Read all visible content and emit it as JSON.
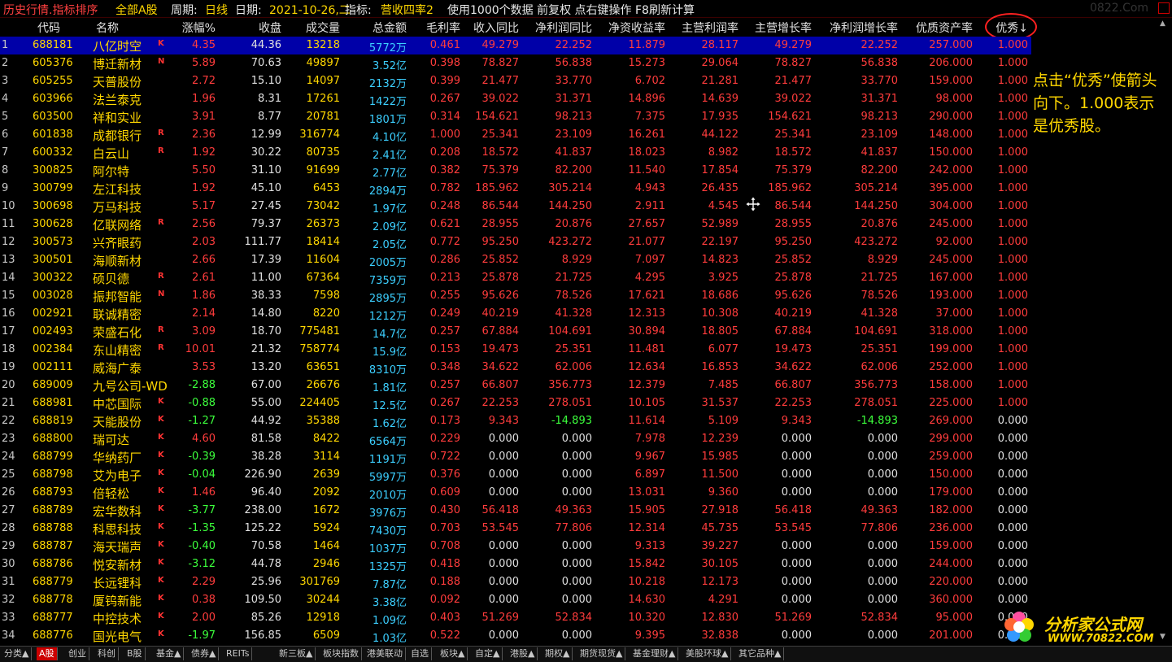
{
  "title": {
    "part1": "历史行情.指标排序",
    "part2": "全部A股",
    "part3": "周期:",
    "part4": "日线",
    "part5": "日期:",
    "part6": "2021-10-26,二",
    "part7": "指标:",
    "part8": "营收四率2",
    "part9": "使用1000个数据 前复权 点右键操作 F8刷新计算",
    "watermark": "0822.Com"
  },
  "columns": [
    "代码",
    "名称",
    "涨幅%",
    "收盘",
    "成交量",
    "总金额",
    "毛利率",
    "收入同比",
    "净利润同比",
    "净资收益率",
    "主营利润率",
    "主营增长率",
    "净利润增长率",
    "优质资产率",
    "优秀↓"
  ],
  "rows": [
    {
      "n": "1",
      "code": "688181",
      "name": "八亿时空",
      "flag": "K",
      "chg": "4.35",
      "close": "44.36",
      "vol": "13218",
      "amt": "5772万",
      "gm": "0.461",
      "rev": "49.279",
      "np": "22.252",
      "roe": "11.879",
      "opm": "28.117",
      "og": "49.279",
      "npg": "22.252",
      "qa": "257.000",
      "ex": "1.000"
    },
    {
      "n": "2",
      "code": "605376",
      "name": "博迁新材",
      "flag": "N",
      "chg": "5.89",
      "close": "70.63",
      "vol": "49897",
      "amt": "3.52亿",
      "gm": "0.398",
      "rev": "78.827",
      "np": "56.838",
      "roe": "15.273",
      "opm": "29.064",
      "og": "78.827",
      "npg": "56.838",
      "qa": "206.000",
      "ex": "1.000"
    },
    {
      "n": "3",
      "code": "605255",
      "name": "天普股份",
      "flag": "",
      "chg": "2.72",
      "close": "15.10",
      "vol": "14097",
      "amt": "2132万",
      "gm": "0.399",
      "rev": "21.477",
      "np": "33.770",
      "roe": "6.702",
      "opm": "21.281",
      "og": "21.477",
      "npg": "33.770",
      "qa": "159.000",
      "ex": "1.000"
    },
    {
      "n": "4",
      "code": "603966",
      "name": "法兰泰克",
      "flag": "",
      "chg": "1.96",
      "close": "8.31",
      "vol": "17261",
      "amt": "1422万",
      "gm": "0.267",
      "rev": "39.022",
      "np": "31.371",
      "roe": "14.896",
      "opm": "14.639",
      "og": "39.022",
      "npg": "31.371",
      "qa": "98.000",
      "ex": "1.000"
    },
    {
      "n": "5",
      "code": "603500",
      "name": "祥和实业",
      "flag": "",
      "chg": "3.91",
      "close": "8.77",
      "vol": "20781",
      "amt": "1801万",
      "gm": "0.314",
      "rev": "154.621",
      "np": "98.213",
      "roe": "7.375",
      "opm": "17.935",
      "og": "154.621",
      "npg": "98.213",
      "qa": "290.000",
      "ex": "1.000"
    },
    {
      "n": "6",
      "code": "601838",
      "name": "成都银行",
      "flag": "R",
      "chg": "2.36",
      "close": "12.99",
      "vol": "316774",
      "amt": "4.10亿",
      "gm": "1.000",
      "rev": "25.341",
      "np": "23.109",
      "roe": "16.261",
      "opm": "44.122",
      "og": "25.341",
      "npg": "23.109",
      "qa": "148.000",
      "ex": "1.000"
    },
    {
      "n": "7",
      "code": "600332",
      "name": "白云山",
      "flag": "R",
      "chg": "1.92",
      "close": "30.22",
      "vol": "80735",
      "amt": "2.41亿",
      "gm": "0.208",
      "rev": "18.572",
      "np": "41.837",
      "roe": "18.023",
      "opm": "8.982",
      "og": "18.572",
      "npg": "41.837",
      "qa": "150.000",
      "ex": "1.000"
    },
    {
      "n": "8",
      "code": "300825",
      "name": "阿尔特",
      "flag": "",
      "chg": "5.50",
      "close": "31.10",
      "vol": "91699",
      "amt": "2.77亿",
      "gm": "0.382",
      "rev": "75.379",
      "np": "82.200",
      "roe": "11.540",
      "opm": "17.854",
      "og": "75.379",
      "npg": "82.200",
      "qa": "242.000",
      "ex": "1.000"
    },
    {
      "n": "9",
      "code": "300799",
      "name": "左江科技",
      "flag": "",
      "chg": "1.92",
      "close": "45.10",
      "vol": "6453",
      "amt": "2894万",
      "gm": "0.782",
      "rev": "185.962",
      "np": "305.214",
      "roe": "4.943",
      "opm": "26.435",
      "og": "185.962",
      "npg": "305.214",
      "qa": "395.000",
      "ex": "1.000"
    },
    {
      "n": "10",
      "code": "300698",
      "name": "万马科技",
      "flag": "",
      "chg": "5.17",
      "close": "27.45",
      "vol": "73042",
      "amt": "1.97亿",
      "gm": "0.248",
      "rev": "86.544",
      "np": "144.250",
      "roe": "2.911",
      "opm": "4.545",
      "og": "86.544",
      "npg": "144.250",
      "qa": "304.000",
      "ex": "1.000"
    },
    {
      "n": "11",
      "code": "300628",
      "name": "亿联网络",
      "flag": "R",
      "chg": "2.56",
      "close": "79.37",
      "vol": "26373",
      "amt": "2.09亿",
      "gm": "0.621",
      "rev": "28.955",
      "np": "20.876",
      "roe": "27.657",
      "opm": "52.989",
      "og": "28.955",
      "npg": "20.876",
      "qa": "245.000",
      "ex": "1.000"
    },
    {
      "n": "12",
      "code": "300573",
      "name": "兴齐眼药",
      "flag": "",
      "chg": "2.03",
      "close": "111.77",
      "vol": "18414",
      "amt": "2.05亿",
      "gm": "0.772",
      "rev": "95.250",
      "np": "423.272",
      "roe": "21.077",
      "opm": "22.197",
      "og": "95.250",
      "npg": "423.272",
      "qa": "92.000",
      "ex": "1.000"
    },
    {
      "n": "13",
      "code": "300501",
      "name": "海顺新材",
      "flag": "",
      "chg": "2.66",
      "close": "17.39",
      "vol": "11604",
      "amt": "2005万",
      "gm": "0.286",
      "rev": "25.852",
      "np": "8.929",
      "roe": "7.097",
      "opm": "14.823",
      "og": "25.852",
      "npg": "8.929",
      "qa": "245.000",
      "ex": "1.000"
    },
    {
      "n": "14",
      "code": "300322",
      "name": "硕贝德",
      "flag": "R",
      "chg": "2.61",
      "close": "11.00",
      "vol": "67364",
      "amt": "7359万",
      "gm": "0.213",
      "rev": "25.878",
      "np": "21.725",
      "roe": "4.295",
      "opm": "3.925",
      "og": "25.878",
      "npg": "21.725",
      "qa": "167.000",
      "ex": "1.000"
    },
    {
      "n": "15",
      "code": "003028",
      "name": "振邦智能",
      "flag": "N",
      "chg": "1.86",
      "close": "38.33",
      "vol": "7598",
      "amt": "2895万",
      "gm": "0.255",
      "rev": "95.626",
      "np": "78.526",
      "roe": "17.621",
      "opm": "18.686",
      "og": "95.626",
      "npg": "78.526",
      "qa": "193.000",
      "ex": "1.000"
    },
    {
      "n": "16",
      "code": "002921",
      "name": "联诚精密",
      "flag": "",
      "chg": "2.14",
      "close": "14.80",
      "vol": "8220",
      "amt": "1212万",
      "gm": "0.249",
      "rev": "40.219",
      "np": "41.328",
      "roe": "12.313",
      "opm": "10.308",
      "og": "40.219",
      "npg": "41.328",
      "qa": "37.000",
      "ex": "1.000"
    },
    {
      "n": "17",
      "code": "002493",
      "name": "荣盛石化",
      "flag": "R",
      "chg": "3.09",
      "close": "18.70",
      "vol": "775481",
      "amt": "14.7亿",
      "gm": "0.257",
      "rev": "67.884",
      "np": "104.691",
      "roe": "30.894",
      "opm": "18.805",
      "og": "67.884",
      "npg": "104.691",
      "qa": "318.000",
      "ex": "1.000"
    },
    {
      "n": "18",
      "code": "002384",
      "name": "东山精密",
      "flag": "R",
      "chg": "10.01",
      "close": "21.32",
      "vol": "758774",
      "amt": "15.9亿",
      "gm": "0.153",
      "rev": "19.473",
      "np": "25.351",
      "roe": "11.481",
      "opm": "6.077",
      "og": "19.473",
      "npg": "25.351",
      "qa": "199.000",
      "ex": "1.000"
    },
    {
      "n": "19",
      "code": "002111",
      "name": "威海广泰",
      "flag": "",
      "chg": "3.53",
      "close": "13.20",
      "vol": "63651",
      "amt": "8310万",
      "gm": "0.348",
      "rev": "34.622",
      "np": "62.006",
      "roe": "12.634",
      "opm": "16.853",
      "og": "34.622",
      "npg": "62.006",
      "qa": "252.000",
      "ex": "1.000"
    },
    {
      "n": "20",
      "code": "689009",
      "name": "九号公司-WD",
      "flag": "",
      "chg": "-2.88",
      "close": "67.00",
      "vol": "26676",
      "amt": "1.81亿",
      "gm": "0.257",
      "rev": "66.807",
      "np": "356.773",
      "roe": "12.379",
      "opm": "7.485",
      "og": "66.807",
      "npg": "356.773",
      "qa": "158.000",
      "ex": "1.000"
    },
    {
      "n": "21",
      "code": "688981",
      "name": "中芯国际",
      "flag": "K",
      "chg": "-0.88",
      "close": "55.00",
      "vol": "224405",
      "amt": "12.5亿",
      "gm": "0.267",
      "rev": "22.253",
      "np": "278.051",
      "roe": "10.105",
      "opm": "31.537",
      "og": "22.253",
      "npg": "278.051",
      "qa": "225.000",
      "ex": "1.000"
    },
    {
      "n": "22",
      "code": "688819",
      "name": "天能股份",
      "flag": "K",
      "chg": "-1.27",
      "close": "44.92",
      "vol": "35388",
      "amt": "1.62亿",
      "gm": "0.173",
      "rev": "9.343",
      "np": "-14.893",
      "roe": "11.614",
      "opm": "5.109",
      "og": "9.343",
      "npg": "-14.893",
      "qa": "269.000",
      "ex": "0.000"
    },
    {
      "n": "23",
      "code": "688800",
      "name": "瑞可达",
      "flag": "K",
      "chg": "4.60",
      "close": "81.58",
      "vol": "8422",
      "amt": "6564万",
      "gm": "0.229",
      "rev": "0.000",
      "np": "0.000",
      "roe": "7.978",
      "opm": "12.239",
      "og": "0.000",
      "npg": "0.000",
      "qa": "299.000",
      "ex": "0.000"
    },
    {
      "n": "24",
      "code": "688799",
      "name": "华纳药厂",
      "flag": "K",
      "chg": "-0.39",
      "close": "38.28",
      "vol": "3114",
      "amt": "1191万",
      "gm": "0.722",
      "rev": "0.000",
      "np": "0.000",
      "roe": "9.967",
      "opm": "15.985",
      "og": "0.000",
      "npg": "0.000",
      "qa": "259.000",
      "ex": "0.000"
    },
    {
      "n": "25",
      "code": "688798",
      "name": "艾为电子",
      "flag": "K",
      "chg": "-0.04",
      "close": "226.90",
      "vol": "2639",
      "amt": "5997万",
      "gm": "0.376",
      "rev": "0.000",
      "np": "0.000",
      "roe": "6.897",
      "opm": "11.500",
      "og": "0.000",
      "npg": "0.000",
      "qa": "150.000",
      "ex": "0.000"
    },
    {
      "n": "26",
      "code": "688793",
      "name": "倍轻松",
      "flag": "K",
      "chg": "1.46",
      "close": "96.40",
      "vol": "2092",
      "amt": "2010万",
      "gm": "0.609",
      "rev": "0.000",
      "np": "0.000",
      "roe": "13.031",
      "opm": "9.360",
      "og": "0.000",
      "npg": "0.000",
      "qa": "179.000",
      "ex": "0.000"
    },
    {
      "n": "27",
      "code": "688789",
      "name": "宏华数科",
      "flag": "K",
      "chg": "-3.77",
      "close": "238.00",
      "vol": "1672",
      "amt": "3976万",
      "gm": "0.430",
      "rev": "56.418",
      "np": "49.363",
      "roe": "15.905",
      "opm": "27.918",
      "og": "56.418",
      "npg": "49.363",
      "qa": "182.000",
      "ex": "0.000"
    },
    {
      "n": "28",
      "code": "688788",
      "name": "科思科技",
      "flag": "K",
      "chg": "-1.35",
      "close": "125.22",
      "vol": "5924",
      "amt": "7430万",
      "gm": "0.703",
      "rev": "53.545",
      "np": "77.806",
      "roe": "12.314",
      "opm": "45.735",
      "og": "53.545",
      "npg": "77.806",
      "qa": "236.000",
      "ex": "0.000"
    },
    {
      "n": "29",
      "code": "688787",
      "name": "海天瑞声",
      "flag": "K",
      "chg": "-0.40",
      "close": "70.58",
      "vol": "1464",
      "amt": "1037万",
      "gm": "0.708",
      "rev": "0.000",
      "np": "0.000",
      "roe": "9.313",
      "opm": "39.227",
      "og": "0.000",
      "npg": "0.000",
      "qa": "159.000",
      "ex": "0.000"
    },
    {
      "n": "30",
      "code": "688786",
      "name": "悦安新材",
      "flag": "K",
      "chg": "-3.12",
      "close": "44.78",
      "vol": "2946",
      "amt": "1325万",
      "gm": "0.418",
      "rev": "0.000",
      "np": "0.000",
      "roe": "15.842",
      "opm": "30.105",
      "og": "0.000",
      "npg": "0.000",
      "qa": "244.000",
      "ex": "0.000"
    },
    {
      "n": "31",
      "code": "688779",
      "name": "长远锂科",
      "flag": "K",
      "chg": "2.29",
      "close": "25.96",
      "vol": "301769",
      "amt": "7.87亿",
      "gm": "0.188",
      "rev": "0.000",
      "np": "0.000",
      "roe": "10.218",
      "opm": "12.173",
      "og": "0.000",
      "npg": "0.000",
      "qa": "220.000",
      "ex": "0.000"
    },
    {
      "n": "32",
      "code": "688778",
      "name": "厦钨新能",
      "flag": "K",
      "chg": "0.38",
      "close": "109.50",
      "vol": "30244",
      "amt": "3.38亿",
      "gm": "0.092",
      "rev": "0.000",
      "np": "0.000",
      "roe": "14.630",
      "opm": "4.291",
      "og": "0.000",
      "npg": "0.000",
      "qa": "360.000",
      "ex": "0.000"
    },
    {
      "n": "33",
      "code": "688777",
      "name": "中控技术",
      "flag": "K",
      "chg": "2.00",
      "close": "85.26",
      "vol": "12918",
      "amt": "1.09亿",
      "gm": "0.403",
      "rev": "51.269",
      "np": "52.834",
      "roe": "10.320",
      "opm": "12.830",
      "og": "51.269",
      "npg": "52.834",
      "qa": "95.000",
      "ex": "0.000"
    },
    {
      "n": "34",
      "code": "688776",
      "name": "国光电气",
      "flag": "K",
      "chg": "-1.97",
      "close": "156.85",
      "vol": "6509",
      "amt": "1.03亿",
      "gm": "0.522",
      "rev": "0.000",
      "np": "0.000",
      "roe": "9.395",
      "opm": "32.838",
      "og": "0.000",
      "npg": "0.000",
      "qa": "201.000",
      "ex": "0.000"
    }
  ],
  "note": "点击“优秀”使箭头向下。1.000表示是优秀股。",
  "tabs": [
    "分类▲",
    "A股",
    "创业",
    "科创",
    "B股",
    "基金▲",
    "债券▲",
    "REITs",
    "新三板▲",
    "板块指数",
    "港美联动",
    "自选",
    "板块▲",
    "自定▲",
    "港股▲",
    "期权▲",
    "期货现货▲",
    "基金理财▲",
    "美股环球▲",
    "其它品种▲"
  ],
  "logo": {
    "text1": "分析家公式网",
    "text2": "WWW.70822.COM"
  },
  "colors": {
    "up": "#ff3c3c",
    "down": "#3cff3c",
    "code": "#ffd700",
    "amount": "#3ccfff",
    "selected": "#0000a8"
  }
}
